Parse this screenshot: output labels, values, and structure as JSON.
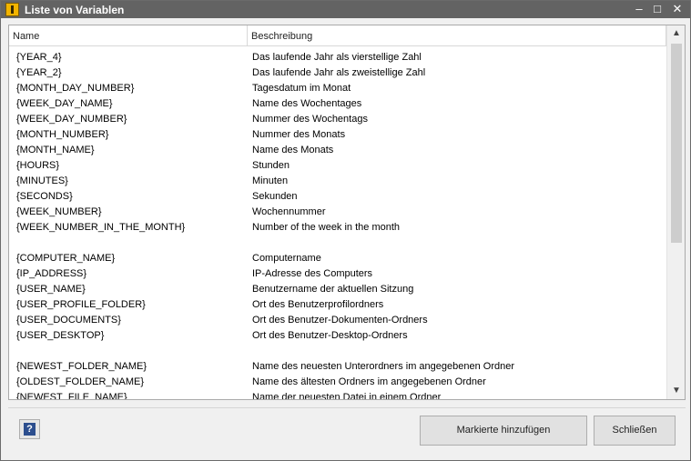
{
  "window": {
    "title": "Liste von Variablen",
    "controls": {
      "minimize": "–",
      "maximize": "□",
      "close": "✕"
    }
  },
  "list": {
    "headers": {
      "name": "Name",
      "description": "Beschreibung"
    },
    "rows": [
      {
        "name": "{YEAR_4}",
        "description": "Das laufende Jahr als vierstellige Zahl"
      },
      {
        "name": "{YEAR_2}",
        "description": "Das laufende Jahr als zweistellige Zahl"
      },
      {
        "name": "{MONTH_DAY_NUMBER}",
        "description": "Tagesdatum im Monat"
      },
      {
        "name": "{WEEK_DAY_NAME}",
        "description": "Name des Wochentages"
      },
      {
        "name": "{WEEK_DAY_NUMBER}",
        "description": "Nummer des Wochentags"
      },
      {
        "name": "{MONTH_NUMBER}",
        "description": "Nummer des Monats"
      },
      {
        "name": "{MONTH_NAME}",
        "description": "Name des Monats"
      },
      {
        "name": "{HOURS}",
        "description": "Stunden"
      },
      {
        "name": "{MINUTES}",
        "description": "Minuten"
      },
      {
        "name": "{SECONDS}",
        "description": "Sekunden"
      },
      {
        "name": "{WEEK_NUMBER}",
        "description": "Wochennummer"
      },
      {
        "name": "{WEEK_NUMBER_IN_THE_MONTH}",
        "description": "Number of the week in the month"
      },
      {
        "name": "",
        "description": ""
      },
      {
        "name": "{COMPUTER_NAME}",
        "description": "Computername"
      },
      {
        "name": "{IP_ADDRESS}",
        "description": "IP-Adresse des Computers"
      },
      {
        "name": "{USER_NAME}",
        "description": "Benutzername der aktuellen Sitzung"
      },
      {
        "name": "{USER_PROFILE_FOLDER}",
        "description": "Ort des Benutzerprofilordners"
      },
      {
        "name": "{USER_DOCUMENTS}",
        "description": "Ort des Benutzer-Dokumenten-Ordners"
      },
      {
        "name": "{USER_DESKTOP}",
        "description": "Ort des Benutzer-Desktop-Ordners"
      },
      {
        "name": "",
        "description": ""
      },
      {
        "name": "{NEWEST_FOLDER_NAME}",
        "description": "Name des neuesten Unterordners im angegebenen Ordner"
      },
      {
        "name": "{OLDEST_FOLDER_NAME}",
        "description": "Name des ältesten Ordners im angegebenen Ordner"
      },
      {
        "name": "{NEWEST_FILE_NAME}",
        "description": "Name der neuesten Datei in einem Ordner"
      }
    ]
  },
  "scrollbar": {
    "up_arrow": "▲",
    "down_arrow": "▼"
  },
  "footer": {
    "help_label": "?",
    "add_selected_label": "Markierte hinzufügen",
    "close_label": "Schließen"
  }
}
